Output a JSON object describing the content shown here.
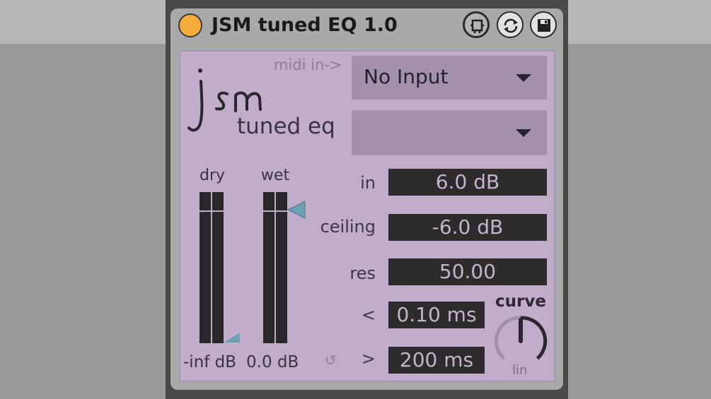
{
  "device": {
    "title": "JSM tuned EQ 1.0",
    "power_color": "#f5ac3b",
    "icons": [
      "focus-icon",
      "sync-icon",
      "save-icon"
    ]
  },
  "logo": {
    "text": "jsm",
    "subtitle": "tuned eq"
  },
  "midi": {
    "label": "midi in->",
    "input_value": "No Input",
    "second_value": ""
  },
  "meters": {
    "dry": {
      "label": "dry",
      "readout": "-inf dB",
      "slider_level": 0.0
    },
    "wet": {
      "label": "wet",
      "readout": "0.0 dB",
      "slider_level": 1.0
    }
  },
  "params": {
    "in": {
      "label": "in",
      "value": "6.0 dB"
    },
    "ceiling": {
      "label": "ceiling",
      "value": "-6.0 dB"
    },
    "res": {
      "label": "res",
      "value": "50.00"
    },
    "attack": {
      "label": "<",
      "value": "0.10 ms"
    },
    "release": {
      "label": ">",
      "value": "200 ms"
    }
  },
  "curve": {
    "label": "curve",
    "mode_label": "lin",
    "value": 0.5
  },
  "colors": {
    "panel": "#c1acc9",
    "dropdown": "#a391ac",
    "numbox_bg": "#2d2b2b",
    "numbox_text": "#c4b3cb",
    "slider_indicator": "#6ea0b4"
  }
}
